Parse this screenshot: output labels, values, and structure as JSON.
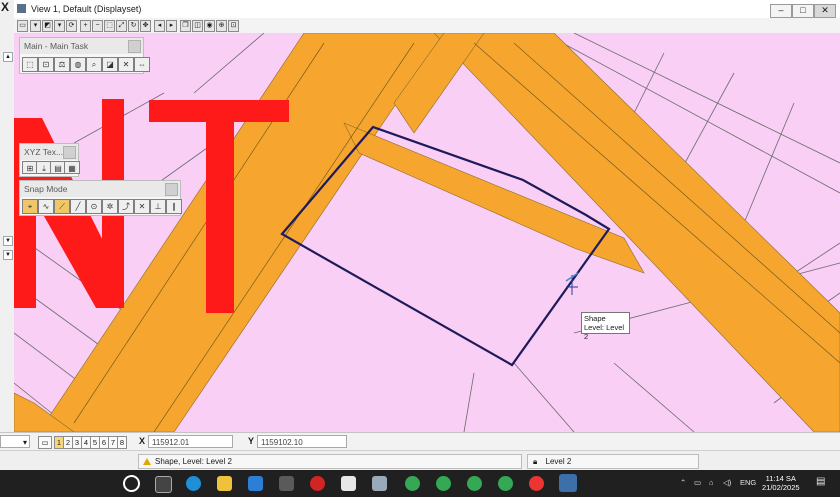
{
  "window": {
    "title": "View 1, Default (Displayset)",
    "close_label": "X"
  },
  "palettes": {
    "main": {
      "title": "Main - Main Task"
    },
    "xyz": {
      "title": "XYZ Tex..."
    },
    "snap": {
      "title": "Snap Mode"
    }
  },
  "tooltip": {
    "line1": "Shape",
    "line2": "Level: Level 2"
  },
  "view_bar": {
    "view_numbers": [
      "1",
      "2",
      "3",
      "4",
      "5",
      "6",
      "7",
      "8"
    ],
    "active_view": "1",
    "x_label": "X",
    "x_value": "115912.01",
    "y_label": "Y",
    "y_value": "1159102.10"
  },
  "status": {
    "message": "Shape, Level: Level 2",
    "level": "Level 2"
  },
  "taskbar": {
    "language": "ENG",
    "time": "11:14 SA",
    "date": "21/02/2025"
  },
  "colors": {
    "canvas_bg": "#f9cff5",
    "road": "#f6a62f",
    "text_red": "#ff1a1a",
    "shape_outline": "#1e1b5a",
    "parcel_lines": "#6b6b6b"
  },
  "drawing": {
    "letters": "NT"
  }
}
